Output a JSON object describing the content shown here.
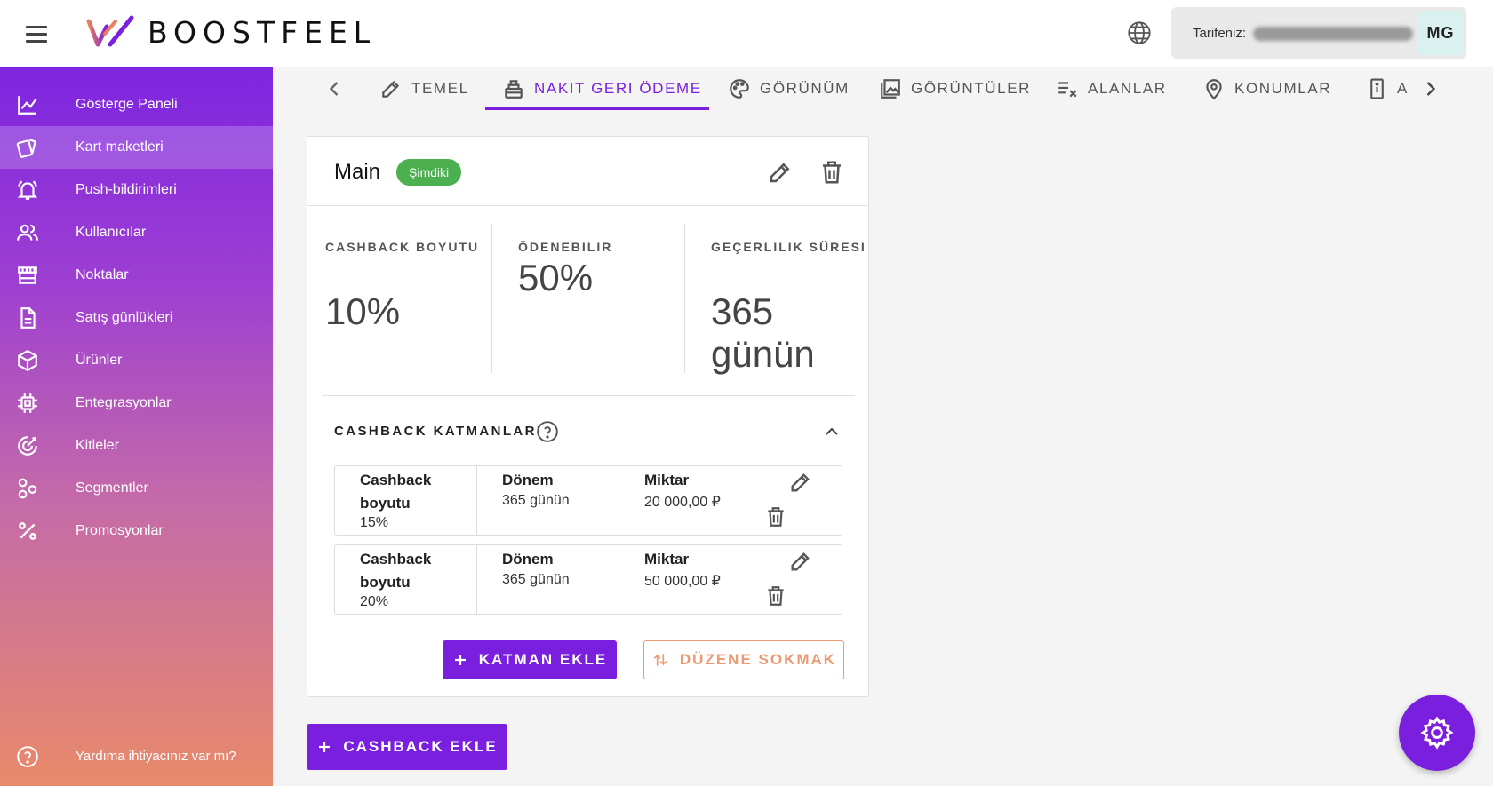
{
  "app": {
    "brand": "BOOSTFEEL",
    "plan_label": "Tarifeniz:",
    "avatar_initials": "MG",
    "accent_color": "#7a1fde"
  },
  "sidebar": {
    "items": [
      {
        "label": "Gösterge Paneli",
        "icon": "chart-line-icon"
      },
      {
        "label": "Kart maketleri",
        "icon": "cards-icon"
      },
      {
        "label": "Push-bildirimleri",
        "icon": "bell-icon"
      },
      {
        "label": "Kullanıcılar",
        "icon": "users-icon"
      },
      {
        "label": "Noktalar",
        "icon": "store-icon"
      },
      {
        "label": "Satış günlükleri",
        "icon": "document-icon"
      },
      {
        "label": "Ürünler",
        "icon": "box-icon"
      },
      {
        "label": "Entegrasyonlar",
        "icon": "chip-icon"
      },
      {
        "label": "Kitleler",
        "icon": "target-icon"
      },
      {
        "label": "Segmentler",
        "icon": "segments-icon"
      },
      {
        "label": "Promosyonlar",
        "icon": "percent-icon"
      }
    ],
    "active_index": 1,
    "help_label": "Yardıma ihtiyacınız var mı?"
  },
  "tabs": [
    {
      "label": "TEMEL",
      "icon": "pencil-icon"
    },
    {
      "label": "NAKIT GERI ÖDEME",
      "icon": "cash-register-icon",
      "active": true
    },
    {
      "label": "GÖRÜNÜM",
      "icon": "palette-icon"
    },
    {
      "label": "GÖRÜNTÜLER",
      "icon": "image-icon"
    },
    {
      "label": "ALANLAR",
      "icon": "list-check-icon"
    },
    {
      "label": "KONUMLAR",
      "icon": "location-pin-icon"
    },
    {
      "label": "A",
      "icon": "phone-info-icon"
    }
  ],
  "card": {
    "title": "Main",
    "badge": "Şimdiki",
    "stats": [
      {
        "label": "CASHBACK BOYUTU",
        "value": "10%"
      },
      {
        "label": "ÖDENEBILIR",
        "value": "50%"
      },
      {
        "label": "GEÇERLILIK SÜRESI",
        "value": "365 günün"
      }
    ],
    "tiers_title": "CASHBACK KATMANLARI",
    "tier_headers": {
      "size": "Cashback boyutu",
      "period": "Dönem",
      "amount": "Miktar"
    },
    "tiers": [
      {
        "size": "15%",
        "period": "365 günün",
        "amount": "20 000,00 ₽"
      },
      {
        "size": "20%",
        "period": "365 günün",
        "amount": "50 000,00 ₽"
      }
    ],
    "add_tier_label": "KATMAN EKLE",
    "reorder_label": "DÜZENE SOKMAK"
  },
  "add_cashback_label": "CASHBACK EKLE"
}
